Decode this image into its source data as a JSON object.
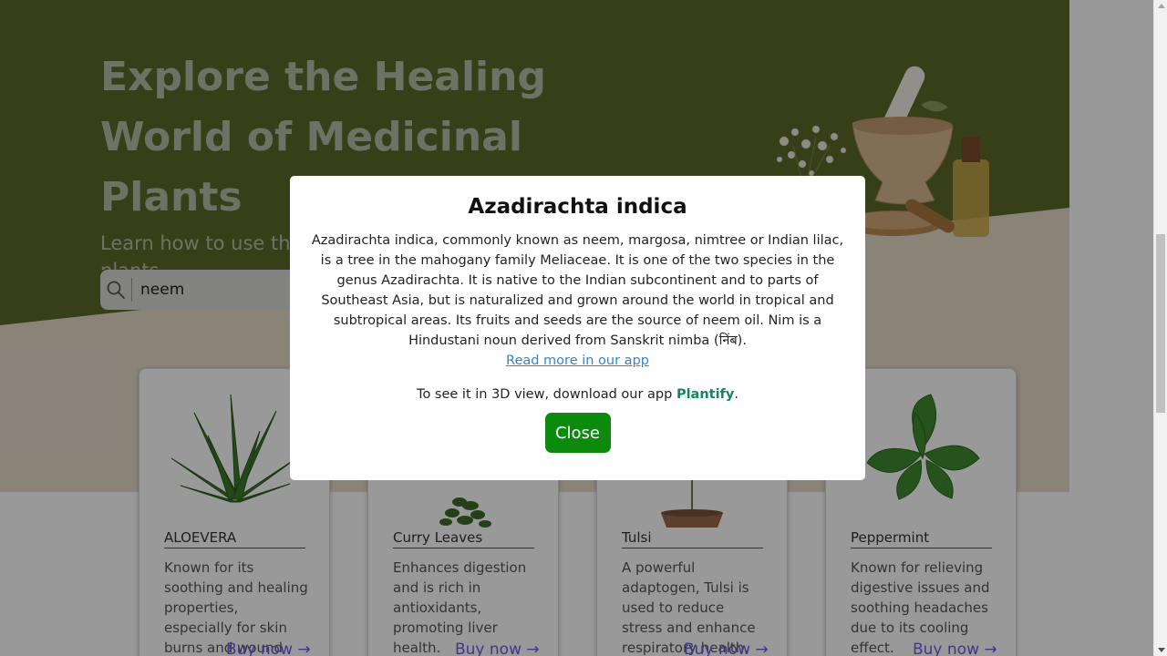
{
  "hero": {
    "title": "Explore the Healing World of Medicinal Plants",
    "subtitle": "Learn how to use the power of healing plants",
    "bg_green": "#5c6a2b",
    "bg_beige": "#e4dac9"
  },
  "search": {
    "value": "neem",
    "icon": "search-icon"
  },
  "cards": [
    {
      "name": "ALOEVERA",
      "desc": "Known for its soothing and healing properties, especially for skin burns and wound",
      "buy": "Buy now",
      "image": "aloe-vera-image"
    },
    {
      "name": "Curry Leaves",
      "desc": "Enhances digestion and is rich in antioxidants, promoting liver health.",
      "buy": "Buy now",
      "image": "curry-leaves-image"
    },
    {
      "name": "Tulsi",
      "desc": "A powerful adaptogen, Tulsi is used to reduce stress and enhance respiratory health.",
      "buy": "Buy now",
      "image": "tulsi-image"
    },
    {
      "name": "Peppermint",
      "desc": "Known for relieving digestive issues and soothing headaches due to its cooling effect.",
      "buy": "Buy now",
      "image": "peppermint-image"
    }
  ],
  "modal": {
    "title": "Azadirachta indica",
    "body": "Azadirachta indica, commonly known as neem, margosa, nimtree or Indian lilac, is a tree in the mahogany family Meliaceae. It is one of the two species in the genus Azadirachta. It is native to the Indian subcontinent and to parts of Southeast Asia, but is naturalized and grown around the world in tropical and subtropical areas. Its fruits and seeds are the source of neem oil. Nim is a Hindustani noun derived from Sanskrit nimba (निंब).",
    "read_more": "Read more in our app",
    "download_prefix": "To see it in 3D view, download our app ",
    "app_name": "Plantify",
    "download_suffix": ".",
    "close_label": "Close",
    "close_color": "#0b8a0b",
    "brand_color": "#11875a"
  }
}
